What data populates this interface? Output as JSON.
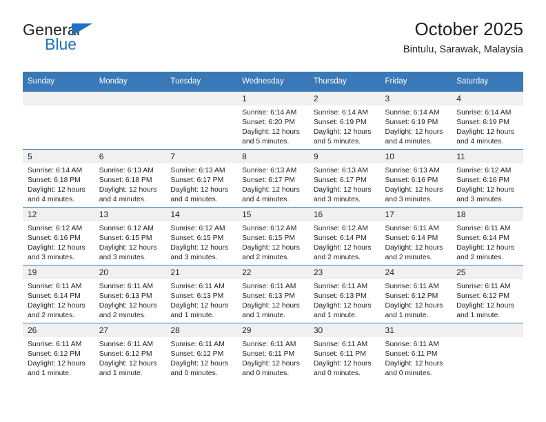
{
  "brand": {
    "name_top": "General",
    "name_bottom": "Blue",
    "triangle_color": "#1f72bd"
  },
  "header": {
    "title": "October 2025",
    "location": "Bintulu, Sarawak, Malaysia"
  },
  "theme": {
    "header_blue": "#3a79b8",
    "daynum_bg": "#f0f0f0",
    "text": "#231f20"
  },
  "weekday_headers": [
    "Sunday",
    "Monday",
    "Tuesday",
    "Wednesday",
    "Thursday",
    "Friday",
    "Saturday"
  ],
  "weeks": [
    [
      {
        "day": "",
        "empty": true
      },
      {
        "day": "",
        "empty": true
      },
      {
        "day": "",
        "empty": true
      },
      {
        "day": "1",
        "sunrise": "Sunrise: 6:14 AM",
        "sunset": "Sunset: 6:20 PM",
        "daylight": "Daylight: 12 hours and 5 minutes."
      },
      {
        "day": "2",
        "sunrise": "Sunrise: 6:14 AM",
        "sunset": "Sunset: 6:19 PM",
        "daylight": "Daylight: 12 hours and 5 minutes."
      },
      {
        "day": "3",
        "sunrise": "Sunrise: 6:14 AM",
        "sunset": "Sunset: 6:19 PM",
        "daylight": "Daylight: 12 hours and 4 minutes."
      },
      {
        "day": "4",
        "sunrise": "Sunrise: 6:14 AM",
        "sunset": "Sunset: 6:19 PM",
        "daylight": "Daylight: 12 hours and 4 minutes."
      }
    ],
    [
      {
        "day": "5",
        "sunrise": "Sunrise: 6:14 AM",
        "sunset": "Sunset: 6:18 PM",
        "daylight": "Daylight: 12 hours and 4 minutes."
      },
      {
        "day": "6",
        "sunrise": "Sunrise: 6:13 AM",
        "sunset": "Sunset: 6:18 PM",
        "daylight": "Daylight: 12 hours and 4 minutes."
      },
      {
        "day": "7",
        "sunrise": "Sunrise: 6:13 AM",
        "sunset": "Sunset: 6:17 PM",
        "daylight": "Daylight: 12 hours and 4 minutes."
      },
      {
        "day": "8",
        "sunrise": "Sunrise: 6:13 AM",
        "sunset": "Sunset: 6:17 PM",
        "daylight": "Daylight: 12 hours and 4 minutes."
      },
      {
        "day": "9",
        "sunrise": "Sunrise: 6:13 AM",
        "sunset": "Sunset: 6:17 PM",
        "daylight": "Daylight: 12 hours and 3 minutes."
      },
      {
        "day": "10",
        "sunrise": "Sunrise: 6:13 AM",
        "sunset": "Sunset: 6:16 PM",
        "daylight": "Daylight: 12 hours and 3 minutes."
      },
      {
        "day": "11",
        "sunrise": "Sunrise: 6:12 AM",
        "sunset": "Sunset: 6:16 PM",
        "daylight": "Daylight: 12 hours and 3 minutes."
      }
    ],
    [
      {
        "day": "12",
        "sunrise": "Sunrise: 6:12 AM",
        "sunset": "Sunset: 6:16 PM",
        "daylight": "Daylight: 12 hours and 3 minutes."
      },
      {
        "day": "13",
        "sunrise": "Sunrise: 6:12 AM",
        "sunset": "Sunset: 6:15 PM",
        "daylight": "Daylight: 12 hours and 3 minutes."
      },
      {
        "day": "14",
        "sunrise": "Sunrise: 6:12 AM",
        "sunset": "Sunset: 6:15 PM",
        "daylight": "Daylight: 12 hours and 3 minutes."
      },
      {
        "day": "15",
        "sunrise": "Sunrise: 6:12 AM",
        "sunset": "Sunset: 6:15 PM",
        "daylight": "Daylight: 12 hours and 2 minutes."
      },
      {
        "day": "16",
        "sunrise": "Sunrise: 6:12 AM",
        "sunset": "Sunset: 6:14 PM",
        "daylight": "Daylight: 12 hours and 2 minutes."
      },
      {
        "day": "17",
        "sunrise": "Sunrise: 6:11 AM",
        "sunset": "Sunset: 6:14 PM",
        "daylight": "Daylight: 12 hours and 2 minutes."
      },
      {
        "day": "18",
        "sunrise": "Sunrise: 6:11 AM",
        "sunset": "Sunset: 6:14 PM",
        "daylight": "Daylight: 12 hours and 2 minutes."
      }
    ],
    [
      {
        "day": "19",
        "sunrise": "Sunrise: 6:11 AM",
        "sunset": "Sunset: 6:14 PM",
        "daylight": "Daylight: 12 hours and 2 minutes."
      },
      {
        "day": "20",
        "sunrise": "Sunrise: 6:11 AM",
        "sunset": "Sunset: 6:13 PM",
        "daylight": "Daylight: 12 hours and 2 minutes."
      },
      {
        "day": "21",
        "sunrise": "Sunrise: 6:11 AM",
        "sunset": "Sunset: 6:13 PM",
        "daylight": "Daylight: 12 hours and 1 minute."
      },
      {
        "day": "22",
        "sunrise": "Sunrise: 6:11 AM",
        "sunset": "Sunset: 6:13 PM",
        "daylight": "Daylight: 12 hours and 1 minute."
      },
      {
        "day": "23",
        "sunrise": "Sunrise: 6:11 AM",
        "sunset": "Sunset: 6:13 PM",
        "daylight": "Daylight: 12 hours and 1 minute."
      },
      {
        "day": "24",
        "sunrise": "Sunrise: 6:11 AM",
        "sunset": "Sunset: 6:12 PM",
        "daylight": "Daylight: 12 hours and 1 minute."
      },
      {
        "day": "25",
        "sunrise": "Sunrise: 6:11 AM",
        "sunset": "Sunset: 6:12 PM",
        "daylight": "Daylight: 12 hours and 1 minute."
      }
    ],
    [
      {
        "day": "26",
        "sunrise": "Sunrise: 6:11 AM",
        "sunset": "Sunset: 6:12 PM",
        "daylight": "Daylight: 12 hours and 1 minute."
      },
      {
        "day": "27",
        "sunrise": "Sunrise: 6:11 AM",
        "sunset": "Sunset: 6:12 PM",
        "daylight": "Daylight: 12 hours and 1 minute."
      },
      {
        "day": "28",
        "sunrise": "Sunrise: 6:11 AM",
        "sunset": "Sunset: 6:12 PM",
        "daylight": "Daylight: 12 hours and 0 minutes."
      },
      {
        "day": "29",
        "sunrise": "Sunrise: 6:11 AM",
        "sunset": "Sunset: 6:11 PM",
        "daylight": "Daylight: 12 hours and 0 minutes."
      },
      {
        "day": "30",
        "sunrise": "Sunrise: 6:11 AM",
        "sunset": "Sunset: 6:11 PM",
        "daylight": "Daylight: 12 hours and 0 minutes."
      },
      {
        "day": "31",
        "sunrise": "Sunrise: 6:11 AM",
        "sunset": "Sunset: 6:11 PM",
        "daylight": "Daylight: 12 hours and 0 minutes."
      },
      {
        "day": "",
        "empty": true
      }
    ]
  ]
}
